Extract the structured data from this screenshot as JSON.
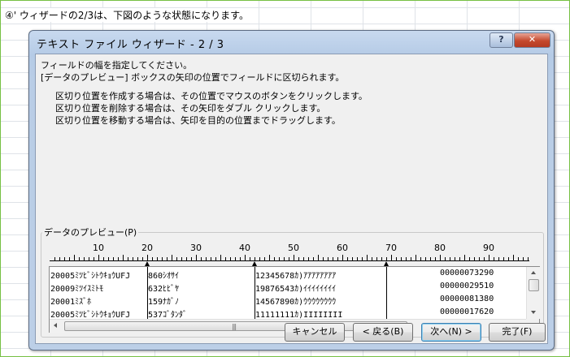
{
  "sheet": {
    "caption": "④' ウィザードの2/3は、下図のような状態になります。"
  },
  "dialog": {
    "title": "テキスト ファイル ウィザード - 2 / 3",
    "help_label": "?",
    "close_label": "✕",
    "instructions": [
      "フィールドの幅を指定してください。",
      "[データのプレビュー] ボックスの矢印の位置でフィールドに区切られます。"
    ],
    "hints": [
      "区切り位置を作成する場合は、その位置でマウスのボタンをクリックします。",
      "区切り位置を削除する場合は、その矢印をダブル クリックします。",
      "区切り位置を移動する場合は、矢印を目的の位置までドラッグします。"
    ],
    "preview_label": "データのプレビュー(P)",
    "ruler_numbers": [
      "10",
      "20",
      "30",
      "40",
      "50",
      "60",
      "70",
      "80",
      "90"
    ],
    "break_columns": [
      20,
      42,
      69
    ],
    "rows": [
      [
        "20005ﾐﾂﾋﾞｼﾄｳｷｮｳUFJ",
        "860ｼｵｻｲ",
        "12345678ｶ)ｱｱｱｱｱｱｱｱ",
        "00000073290"
      ],
      [
        "20009ﾐﾂｲｽﾐﾄﾓ",
        "632ﾋﾋﾞﾔ",
        "19876543ｶ)ｲｲｲｲｲｲｲｲ",
        "00000029510"
      ],
      [
        "20001ﾐｽﾞﾎ",
        "159ﾅｶﾞﾉ",
        "14567890ｶ)ｳｳｳｳｳｳｳｳ",
        "00000081380"
      ],
      [
        "20005ﾐﾂﾋﾞｼﾄｳｷｮｳUFJ",
        "537ｺﾞﾀﾝﾀﾞ",
        "11111111ｶ)IIIIIIII",
        "00000017620"
      ]
    ],
    "buttons": {
      "cancel": "キャンセル",
      "back": "< 戻る(B)",
      "next": "次へ(N) >",
      "finish": "完了(F)"
    }
  }
}
